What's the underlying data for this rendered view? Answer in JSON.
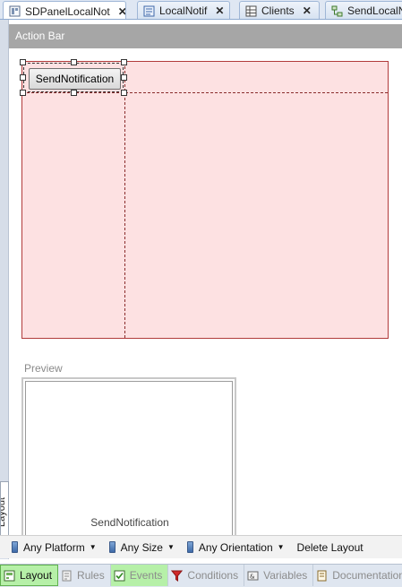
{
  "tabs": [
    {
      "label": "SDPanelLocalNot",
      "icon": "panel-icon",
      "close": "✕"
    },
    {
      "label": "LocalNotif",
      "icon": "object-icon",
      "close": "✕"
    },
    {
      "label": "Clients",
      "icon": "grid-icon",
      "close": "✕"
    },
    {
      "label": "SendLocalN",
      "icon": "procedure-icon"
    }
  ],
  "action_bar": {
    "title": "Action Bar"
  },
  "canvas": {
    "button_label": "SendNotification"
  },
  "preview": {
    "label": "Preview",
    "button_text": "SendNotification"
  },
  "side_tab": {
    "label": "Layout"
  },
  "bottom_toolbar": {
    "platform": "Any Platform",
    "size": "Any Size",
    "orientation": "Any Orientation",
    "delete": "Delete Layout"
  },
  "view_tabs": [
    {
      "label": "Layout",
      "icon": "layout-icon"
    },
    {
      "label": "Rules",
      "icon": "rules-icon"
    },
    {
      "label": "Events",
      "icon": "events-icon"
    },
    {
      "label": "Conditions",
      "icon": "filter-icon"
    },
    {
      "label": "Variables",
      "icon": "variables-icon"
    },
    {
      "label": "Documentation",
      "icon": "documentation-icon"
    }
  ],
  "colors": {
    "canvas_fill": "#fde1e2",
    "canvas_border": "#b13b3b",
    "action_bar": "#a6a6a6",
    "active_view_tab": "#b6f0a8"
  }
}
